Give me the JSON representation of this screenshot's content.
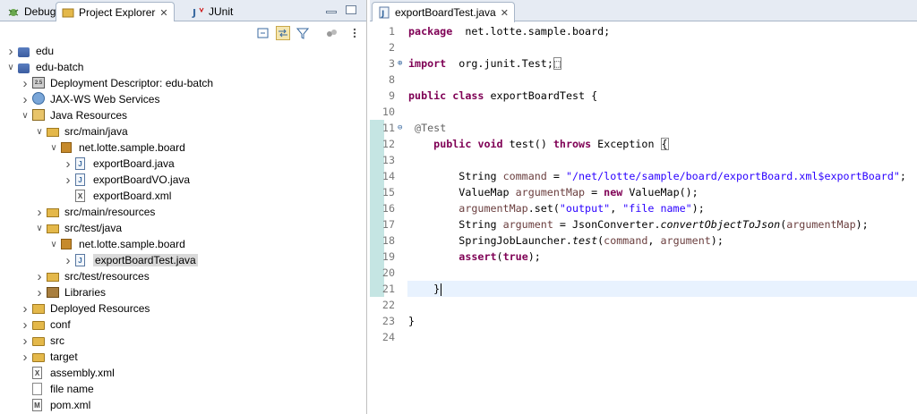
{
  "left_panel": {
    "tabs": [
      {
        "label": "Debug",
        "icon": "bug-icon"
      },
      {
        "label": "Project Explorer",
        "icon": "explorer-icon",
        "close": "✕"
      },
      {
        "label": "JUnit",
        "icon": "junit-icon"
      }
    ],
    "toolbar_icons": [
      "collapse-all-icon",
      "link-with-editor-icon",
      "filter-icon",
      "focus-icon",
      "view-menu-icon"
    ],
    "tree": [
      {
        "label": "edu",
        "depth": 0,
        "expand": "›",
        "icon": "java-project-icon"
      },
      {
        "label": "edu-batch",
        "depth": 0,
        "expand": "⌄",
        "icon": "java-project-icon"
      },
      {
        "label": "Deployment Descriptor: edu-batch",
        "depth": 1,
        "expand": "›",
        "icon": "deployment-descriptor-icon"
      },
      {
        "label": "JAX-WS Web Services",
        "depth": 1,
        "expand": "›",
        "icon": "web-services-icon"
      },
      {
        "label": "Java Resources",
        "depth": 1,
        "expand": "⌄",
        "icon": "java-resources-icon"
      },
      {
        "label": "src/main/java",
        "depth": 2,
        "expand": "⌄",
        "icon": "source-folder-icon"
      },
      {
        "label": "net.lotte.sample.board",
        "depth": 3,
        "expand": "⌄",
        "icon": "package-icon"
      },
      {
        "label": "exportBoard.java",
        "depth": 4,
        "expand": "›",
        "icon": "java-file-icon"
      },
      {
        "label": "exportBoardVO.java",
        "depth": 4,
        "expand": "›",
        "icon": "java-file-icon"
      },
      {
        "label": "exportBoard.xml",
        "depth": 4,
        "expand": "",
        "icon": "xml-file-icon"
      },
      {
        "label": "src/main/resources",
        "depth": 2,
        "expand": "›",
        "icon": "source-folder-icon"
      },
      {
        "label": "src/test/java",
        "depth": 2,
        "expand": "⌄",
        "icon": "source-folder-icon"
      },
      {
        "label": "net.lotte.sample.board",
        "depth": 3,
        "expand": "⌄",
        "icon": "package-icon"
      },
      {
        "label": "exportBoardTest.java",
        "depth": 4,
        "expand": "›",
        "icon": "java-file-icon",
        "selected": true
      },
      {
        "label": "src/test/resources",
        "depth": 2,
        "expand": "›",
        "icon": "source-folder-icon"
      },
      {
        "label": "Libraries",
        "depth": 2,
        "expand": "›",
        "icon": "libraries-icon"
      },
      {
        "label": "Deployed Resources",
        "depth": 1,
        "expand": "›",
        "icon": "deployed-resources-icon"
      },
      {
        "label": "conf",
        "depth": 1,
        "expand": "›",
        "icon": "folder-icon"
      },
      {
        "label": "src",
        "depth": 1,
        "expand": "›",
        "icon": "folder-icon"
      },
      {
        "label": "target",
        "depth": 1,
        "expand": "›",
        "icon": "folder-icon"
      },
      {
        "label": "assembly.xml",
        "depth": 1,
        "expand": "",
        "icon": "xml-file-icon"
      },
      {
        "label": "file name",
        "depth": 1,
        "expand": "",
        "icon": "text-file-icon"
      },
      {
        "label": "pom.xml",
        "depth": 1,
        "expand": "",
        "icon": "maven-pom-icon"
      }
    ]
  },
  "editor": {
    "tab": {
      "label": "exportBoardTest.java",
      "close": "✕",
      "icon": "java-file-icon"
    },
    "lines": [
      {
        "n": "1",
        "parts": [
          [
            "kw",
            "package"
          ],
          [
            "",
            "  net.lotte.sample.board;"
          ]
        ]
      },
      {
        "n": "2",
        "parts": []
      },
      {
        "n": "3",
        "fold": "⊕",
        "parts": [
          [
            "kw",
            "import"
          ],
          [
            "",
            "  org.junit.Test;"
          ],
          [
            "box",
            "⬚"
          ]
        ]
      },
      {
        "n": "8",
        "parts": []
      },
      {
        "n": "9",
        "parts": [
          [
            "kw",
            "public"
          ],
          [
            "",
            " "
          ],
          [
            "kw",
            "class"
          ],
          [
            "",
            " exportBoardTest {"
          ]
        ]
      },
      {
        "n": "10",
        "parts": []
      },
      {
        "n": "11",
        "fold": "⊖",
        "parts": [
          [
            "",
            " "
          ],
          [
            "ann",
            "@Test"
          ]
        ]
      },
      {
        "n": "12",
        "parts": [
          [
            "",
            "    "
          ],
          [
            "kw",
            "public"
          ],
          [
            "",
            " "
          ],
          [
            "kw",
            "void"
          ],
          [
            "",
            " test() "
          ],
          [
            "kw",
            "throws"
          ],
          [
            "",
            " Exception "
          ],
          [
            "box",
            "{"
          ]
        ]
      },
      {
        "n": "13",
        "parts": []
      },
      {
        "n": "14",
        "parts": [
          [
            "",
            "        String "
          ],
          [
            "var",
            "command"
          ],
          [
            "",
            " = "
          ],
          [
            "str",
            "\"/net/lotte/sample/board/exportBoard.xml$exportBoard\""
          ],
          [
            "",
            ";"
          ]
        ]
      },
      {
        "n": "15",
        "parts": [
          [
            "",
            "        ValueMap "
          ],
          [
            "var",
            "argumentMap"
          ],
          [
            "",
            " = "
          ],
          [
            "kw",
            "new"
          ],
          [
            "",
            " ValueMap();"
          ]
        ]
      },
      {
        "n": "16",
        "parts": [
          [
            "",
            "        "
          ],
          [
            "var",
            "argumentMap"
          ],
          [
            "",
            ".set("
          ],
          [
            "str",
            "\"output\""
          ],
          [
            "",
            ", "
          ],
          [
            "str",
            "\"file name\""
          ],
          [
            "",
            ");"
          ]
        ]
      },
      {
        "n": "17",
        "parts": [
          [
            "",
            "        String "
          ],
          [
            "var",
            "argument"
          ],
          [
            "",
            " = JsonConverter."
          ],
          [
            "it",
            "convertObjectToJson"
          ],
          [
            "",
            "("
          ],
          [
            "var",
            "argumentMap"
          ],
          [
            "",
            ");"
          ]
        ]
      },
      {
        "n": "18",
        "parts": [
          [
            "",
            "        SpringJobLauncher."
          ],
          [
            "it",
            "test"
          ],
          [
            "",
            "("
          ],
          [
            "var",
            "command"
          ],
          [
            "",
            ", "
          ],
          [
            "var",
            "argument"
          ],
          [
            "",
            ");"
          ]
        ]
      },
      {
        "n": "19",
        "parts": [
          [
            "",
            "        "
          ],
          [
            "kw",
            "assert"
          ],
          [
            "",
            "("
          ],
          [
            "kw",
            "true"
          ],
          [
            "",
            ");"
          ]
        ]
      },
      {
        "n": "20",
        "parts": []
      },
      {
        "n": "21",
        "current": true,
        "parts": [
          [
            "",
            "    }"
          ]
        ]
      },
      {
        "n": "22",
        "parts": []
      },
      {
        "n": "23",
        "parts": [
          [
            "",
            "}"
          ]
        ]
      },
      {
        "n": "24",
        "parts": []
      }
    ]
  },
  "colors": {
    "keyword": "#7f0055",
    "string": "#2a00ff",
    "annotation": "#646464",
    "variable": "#6a3e3e",
    "current_line": "#e8f2fe",
    "change_ruler": "#c5e5e3"
  }
}
